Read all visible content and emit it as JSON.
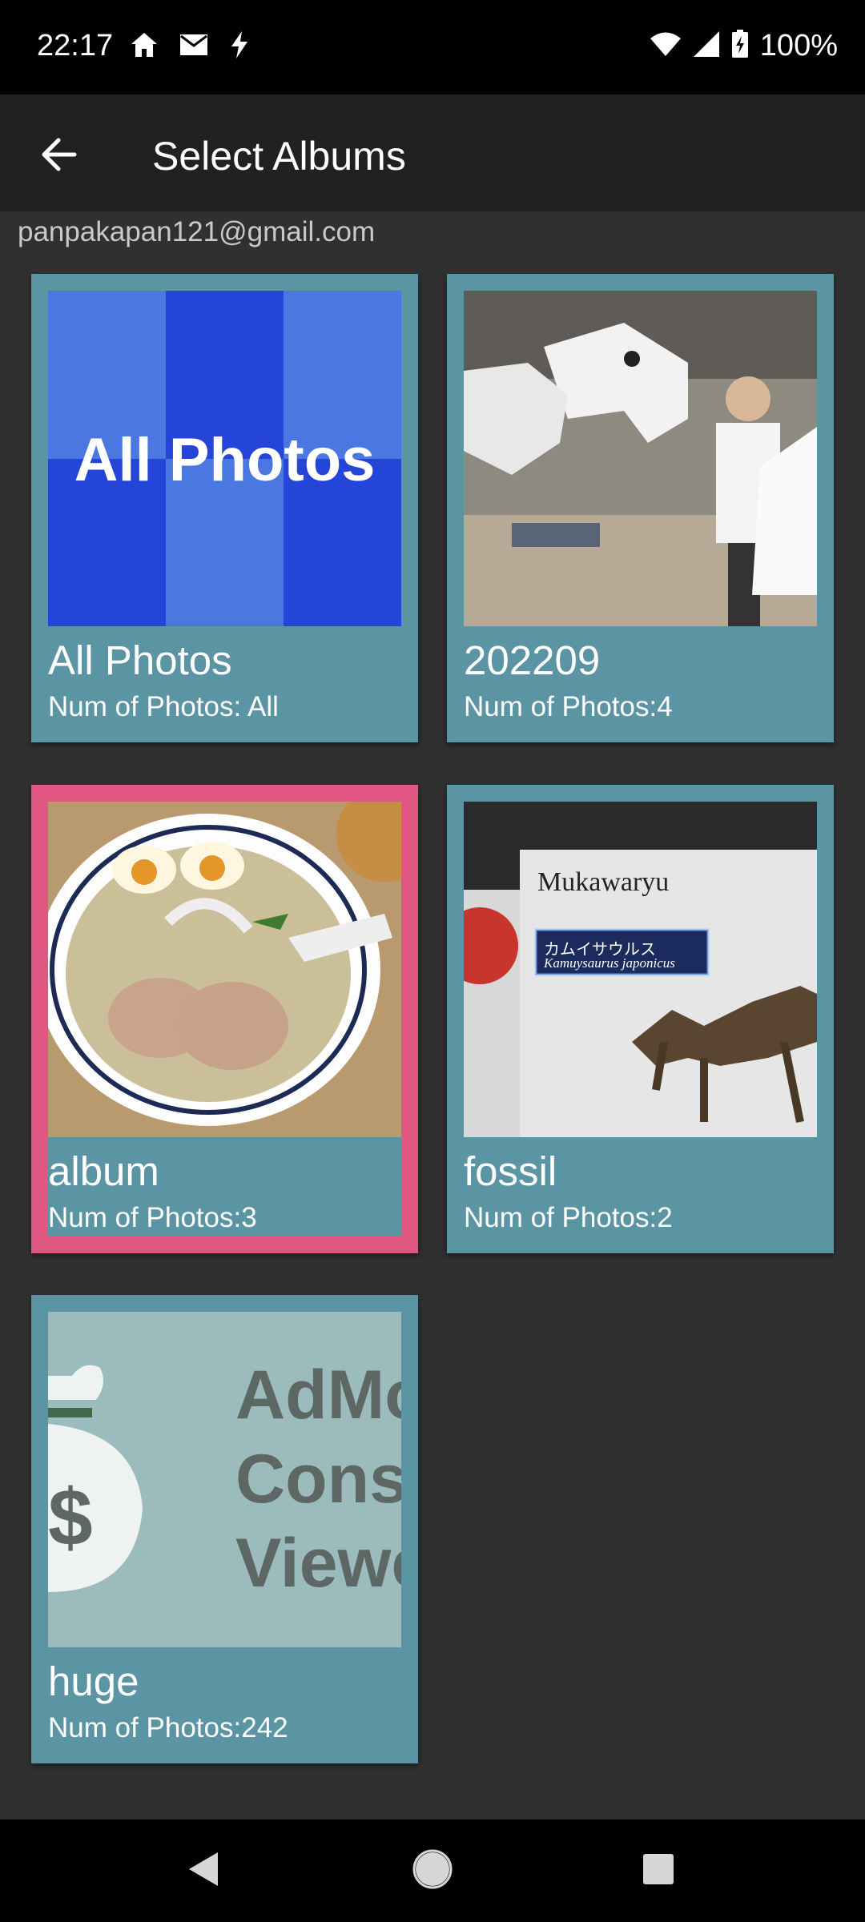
{
  "status_bar": {
    "time": "22:17",
    "battery": "100%",
    "left_icons": [
      "home-icon",
      "mail-icon",
      "flash-icon"
    ],
    "right_icons": [
      "wifi-icon",
      "signal-icon",
      "battery-charging-icon"
    ]
  },
  "app_bar": {
    "back_icon": "arrow-back-icon",
    "title": "Select Albums"
  },
  "account": {
    "email": "panpakapan121@gmail.com"
  },
  "albums": [
    {
      "name": "All Photos",
      "count_text": "Num of Photos: All",
      "thumb_text": "All Photos",
      "selected": false
    },
    {
      "name": "202209",
      "count_text": "Num of Photos:4",
      "selected": false
    },
    {
      "name": "album",
      "count_text": "Num of Photos:3",
      "selected": true
    },
    {
      "name": "fossil",
      "count_text": "Num of Photos:2",
      "selected": false,
      "thumb_text_lines": [
        "Mukawaryu",
        "カムイサウルス",
        "Kamuysaurus japonicus"
      ]
    },
    {
      "name": "huge",
      "count_text": "Num of Photos:242",
      "selected": false,
      "thumb_text_lines": [
        "AdMo",
        "Conso",
        "Viewe"
      ],
      "thumb_symbol": "$"
    }
  ],
  "colors": {
    "background": "#303030",
    "app_bar": "#212121",
    "card": "#5b95a3",
    "card_selected": "#e05781"
  },
  "nav_bar": {
    "icons": [
      "nav-back-icon",
      "nav-home-icon",
      "nav-recents-icon"
    ]
  }
}
